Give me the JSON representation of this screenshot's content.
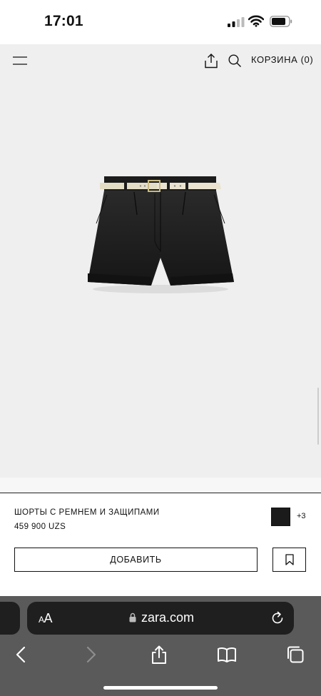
{
  "status_bar": {
    "time": "17:01"
  },
  "header": {
    "menu_icon": "hamburger-icon",
    "share_icon": "share-icon",
    "search_icon": "search-icon",
    "cart_label": "КОРЗИНА (0)"
  },
  "product": {
    "name": "ШОРТЫ С РЕМНЕМ И ЗАЩИПАМИ",
    "price": "459 900 UZS",
    "selected_color": "#1b1b1b",
    "more_colors": "+3",
    "add_button_label": "ДОБАВИТЬ",
    "bookmark_icon": "bookmark-icon"
  },
  "browser": {
    "text_size_small": "A",
    "text_size_large": "A",
    "url": "zara.com",
    "lock_icon": "lock-icon",
    "reload_icon": "reload-icon",
    "toolbar_icons": [
      "back-icon",
      "forward-icon",
      "share-icon",
      "bookmarks-icon",
      "tabs-icon"
    ]
  }
}
